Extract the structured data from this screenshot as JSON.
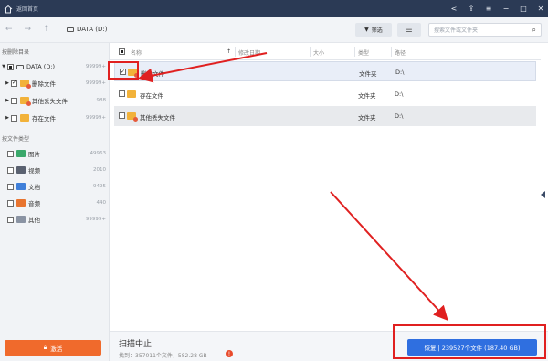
{
  "titlebar": {
    "title": "返回首页"
  },
  "toolbar": {
    "drive": "DATA (D:)",
    "filter_label": "筛选",
    "search_placeholder": "搜索文件或文件夹"
  },
  "sidebar": {
    "section_dir": "按删除目录",
    "tree": [
      {
        "label": "DATA (D:)",
        "count": "99999+"
      },
      {
        "label": "删除文件",
        "count": "99999+"
      },
      {
        "label": "其他丢失文件",
        "count": "988"
      },
      {
        "label": "存在文件",
        "count": "99999+"
      }
    ],
    "section_types": "按文件类型",
    "types": [
      {
        "label": "图片",
        "count": "49963"
      },
      {
        "label": "视频",
        "count": "2010"
      },
      {
        "label": "文档",
        "count": "9495"
      },
      {
        "label": "音频",
        "count": "440"
      },
      {
        "label": "其他",
        "count": "99999+"
      }
    ],
    "activate_label": "激活"
  },
  "table": {
    "headers": {
      "name": "名称",
      "modified": "修改日期",
      "size": "大小",
      "type": "类型",
      "path": "路径"
    },
    "rows": [
      {
        "name": "删除文件",
        "type": "文件夹",
        "path": "D:\\"
      },
      {
        "name": "存在文件",
        "type": "文件夹",
        "path": "D:\\"
      },
      {
        "name": "其他丢失文件",
        "type": "文件夹",
        "path": "D:\\"
      }
    ]
  },
  "status": {
    "title": "扫描中止",
    "found": "找到：357011个文件，582.28 GB",
    "recover_label": "恢复 | 239527个文件 (187.40 GB)"
  },
  "colors": {
    "accent": "#2f6fe0",
    "activate": "#f06a2c",
    "annotation": "#e02020",
    "titlebar": "#2b3a55"
  }
}
